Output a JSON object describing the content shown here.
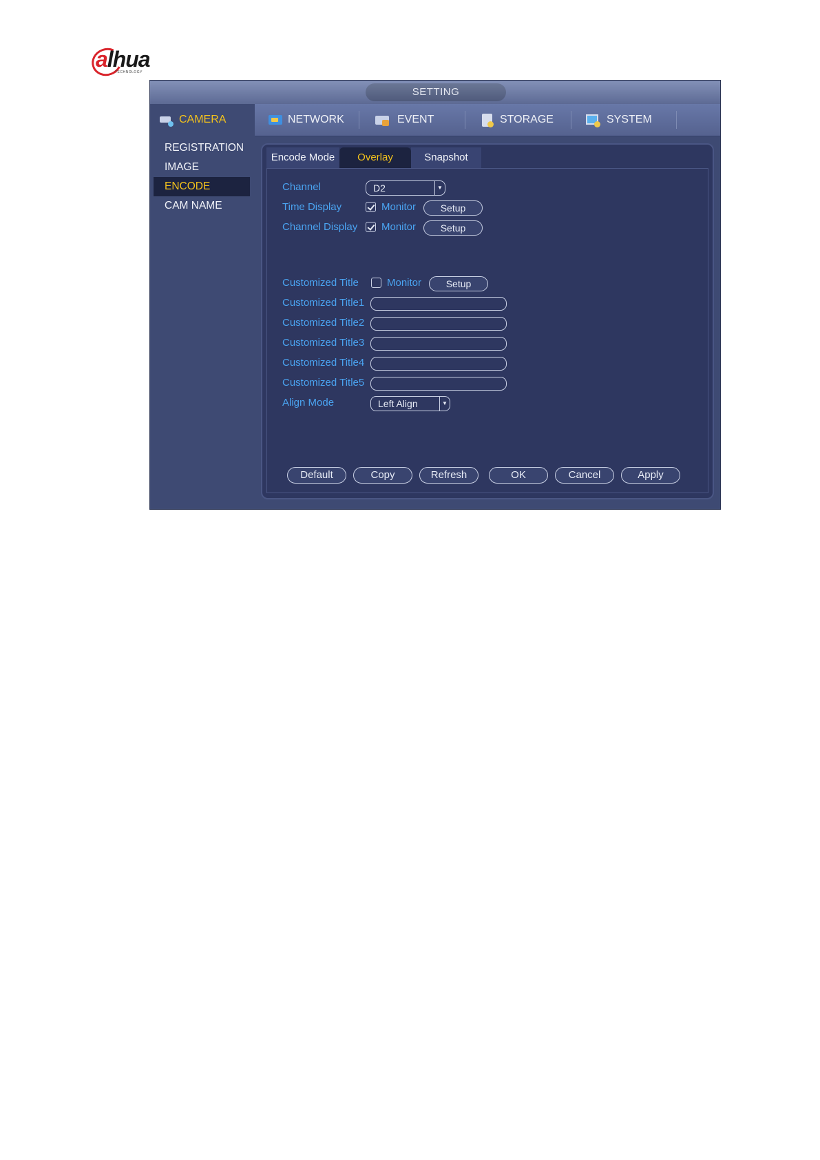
{
  "logo": {
    "text_a": "a",
    "text_rest": "lhua",
    "subtitle": "TECHNOLOGY"
  },
  "window": {
    "title": "SETTING",
    "nav": [
      {
        "label": "CAMERA",
        "icon": "camera-icon"
      },
      {
        "label": "NETWORK",
        "icon": "network-icon"
      },
      {
        "label": "EVENT",
        "icon": "event-icon"
      },
      {
        "label": "STORAGE",
        "icon": "storage-icon"
      },
      {
        "label": "SYSTEM",
        "icon": "system-icon"
      }
    ],
    "sidebar": [
      {
        "label": "REGISTRATION"
      },
      {
        "label": "IMAGE"
      },
      {
        "label": "ENCODE",
        "active": true
      },
      {
        "label": "CAM NAME"
      }
    ],
    "tabs": [
      {
        "label": "Encode Mode"
      },
      {
        "label": "Overlay",
        "active": true
      },
      {
        "label": "Snapshot"
      }
    ],
    "form": {
      "channel_label": "Channel",
      "channel_value": "D2",
      "time_display_label": "Time Display",
      "time_display_monitor": "Monitor",
      "time_display_checked": true,
      "channel_display_label": "Channel Display",
      "channel_display_monitor": "Monitor",
      "channel_display_checked": true,
      "setup_label": "Setup",
      "customized_title_label": "Customized Title",
      "customized_title_monitor": "Monitor",
      "customized_title_checked": false,
      "titles": [
        {
          "label": "Customized Title1",
          "value": ""
        },
        {
          "label": "Customized Title2",
          "value": ""
        },
        {
          "label": "Customized Title3",
          "value": ""
        },
        {
          "label": "Customized Title4",
          "value": ""
        },
        {
          "label": "Customized Title5",
          "value": ""
        }
      ],
      "align_mode_label": "Align Mode",
      "align_mode_value": "Left Align"
    },
    "buttons": {
      "default": "Default",
      "copy": "Copy",
      "refresh": "Refresh",
      "ok": "OK",
      "cancel": "Cancel",
      "apply": "Apply"
    }
  }
}
